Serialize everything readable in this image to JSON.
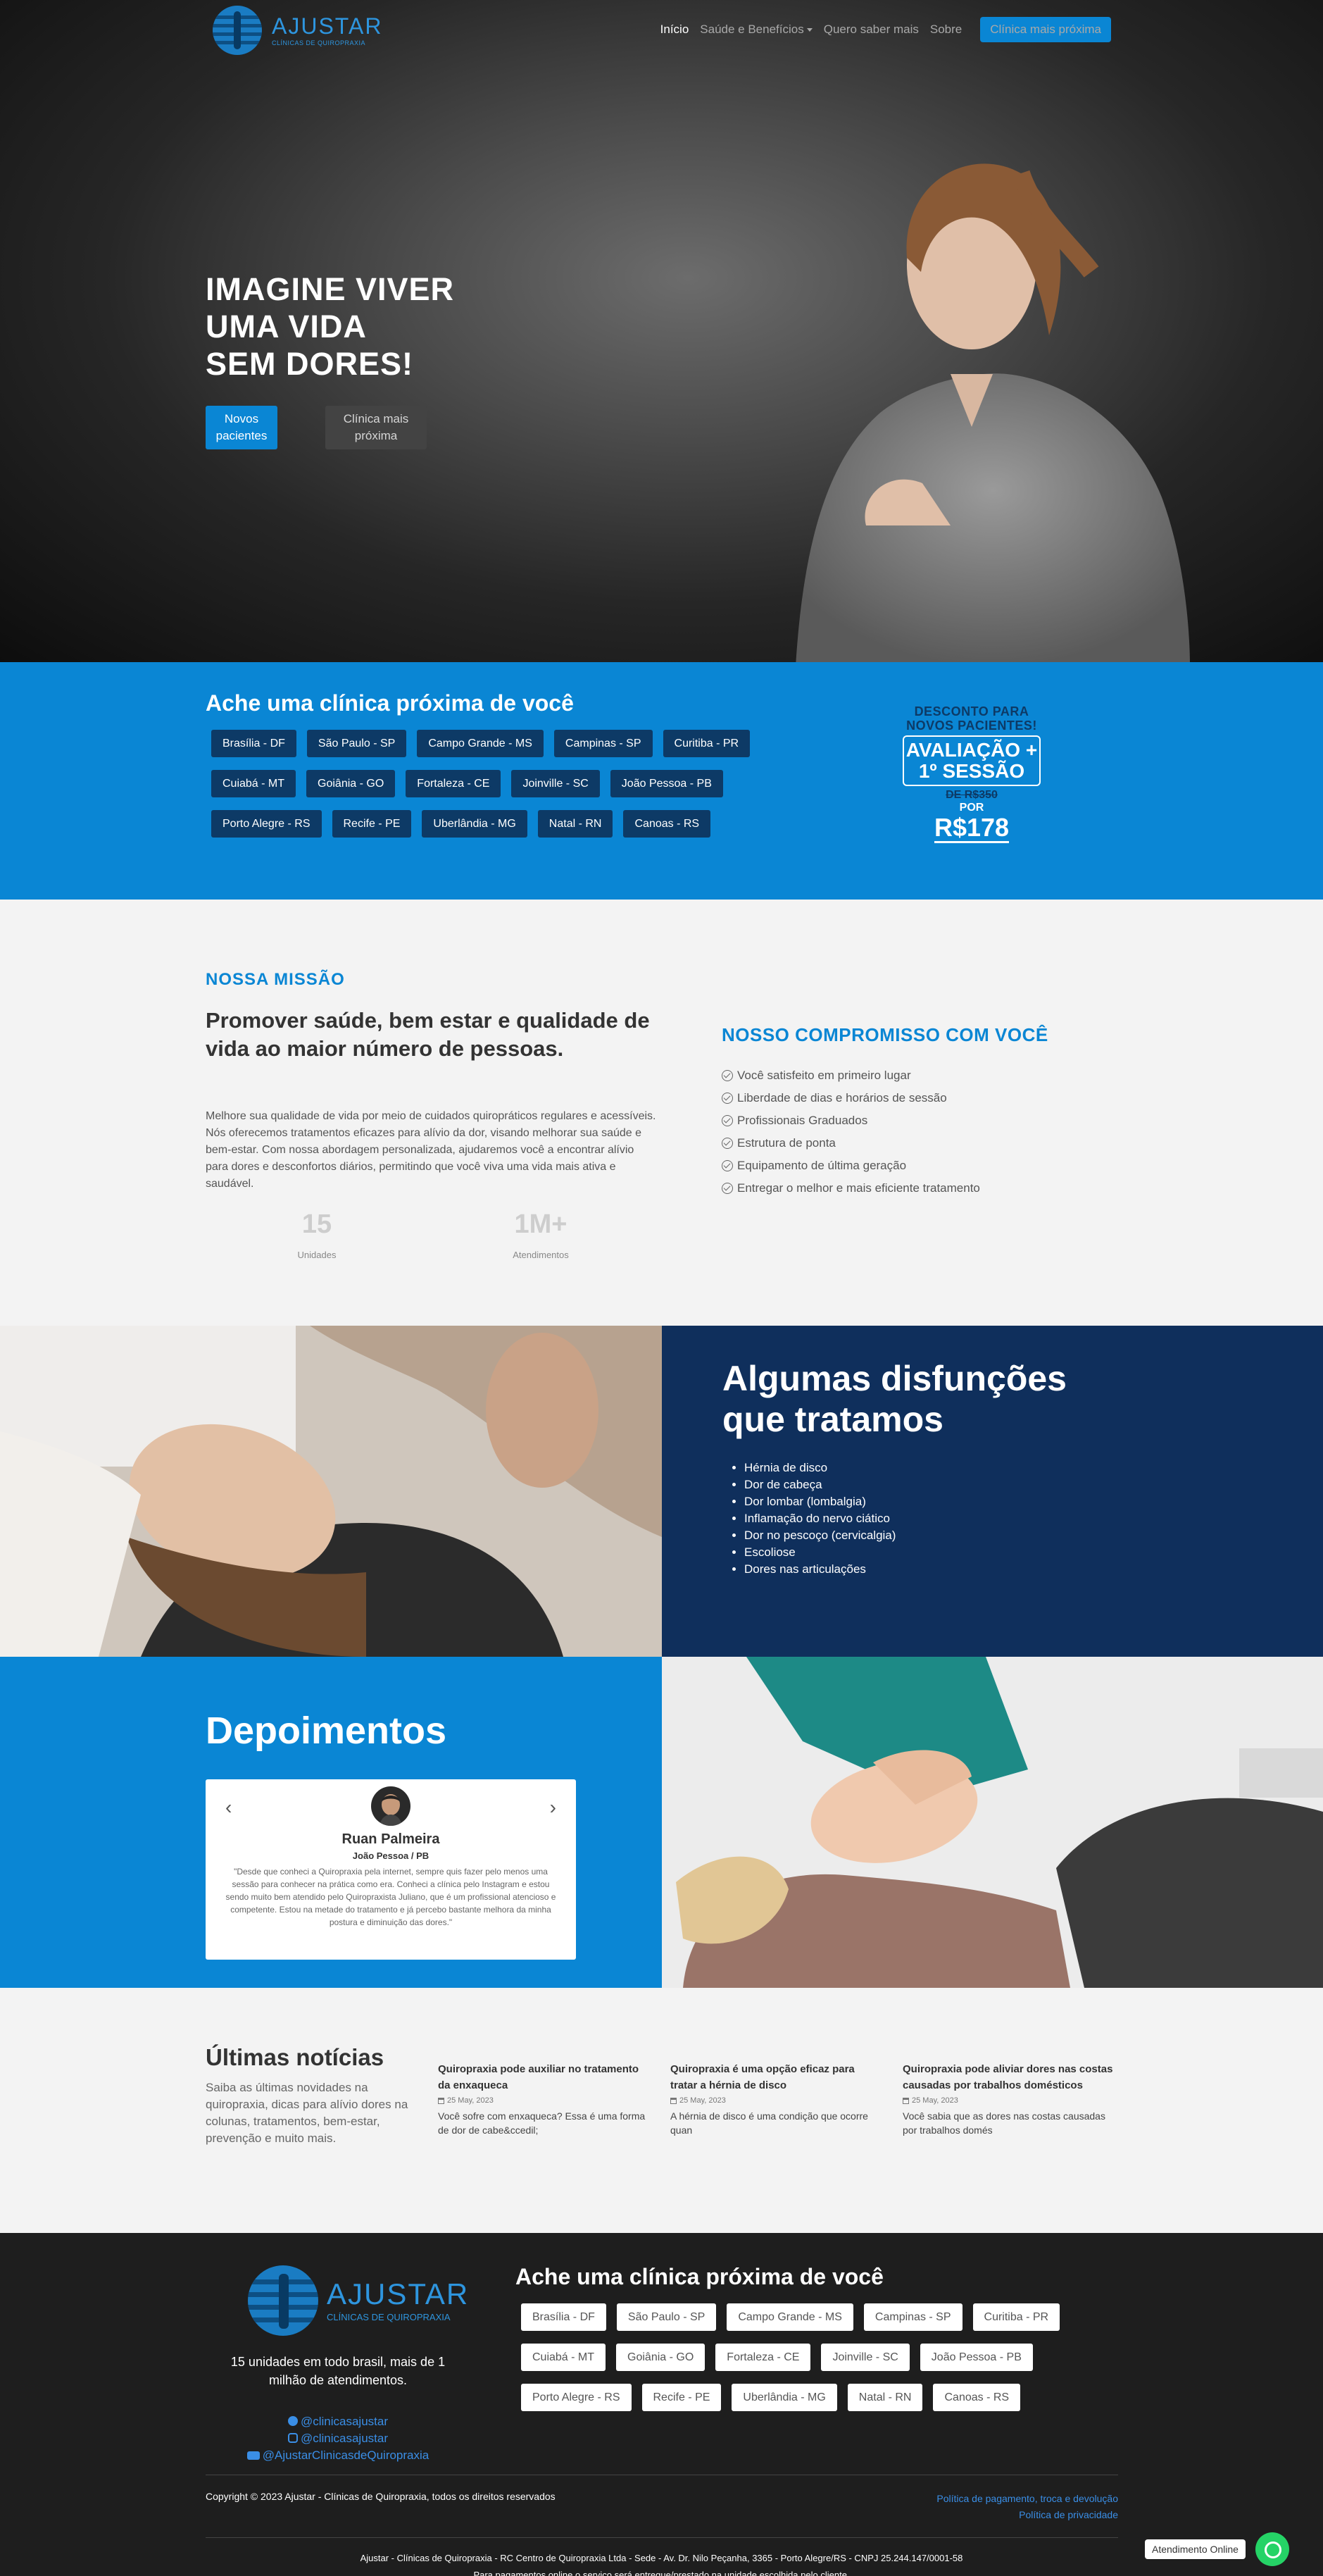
{
  "header": {
    "brand": "AJUSTAR",
    "brand_sub": "CLÍNICAS DE QUIROPRAXIA",
    "nav": [
      "Início",
      "Saúde e Benefícios",
      "Quero saber mais",
      "Sobre"
    ],
    "cta": "Clínica mais próxima"
  },
  "hero": {
    "title_lines": [
      "IMAGINE VIVER",
      "UMA VIDA",
      "SEM DORES!"
    ],
    "btn_primary": "Novos pacientes",
    "btn_secondary": "Clínica mais próxima"
  },
  "find": {
    "title": "Ache uma clínica próxima de você",
    "rows": [
      [
        "Brasília - DF",
        "São Paulo - SP",
        "Campo Grande - MS",
        "Campinas - SP",
        "Curitiba - PR"
      ],
      [
        "Cuiabá - MT",
        "Goiânia - GO",
        "Fortaleza - CE",
        "Joinville - SC",
        "João Pessoa - PB"
      ],
      [
        "Porto Alegre - RS",
        "Recife - PE",
        "Uberlândia - MG",
        "Natal - RN",
        "Canoas - RS"
      ]
    ],
    "promo": {
      "line1": "DESCONTO PARA NOVOS PACIENTES!",
      "line2": "AVALIAÇÃO + 1º SESSÃO",
      "old_price": "DE R$350",
      "por": "POR",
      "price": "R$178"
    }
  },
  "mission": {
    "kicker": "NOSSA MISSÃO",
    "headline": "Promover saúde, bem estar e qualidade de vida ao maior número de pessoas.",
    "body": "Melhore sua qualidade de vida por meio de cuidados quiropráticos regulares e acessíveis. Nós oferecemos tratamentos eficazes para alívio da dor, visando melhorar sua saúde e bem-estar. Com nossa abordagem personalizada, ajudaremos você a encontrar alívio para dores e desconfortos diários, permitindo que você viva uma vida mais ativa e saudável.",
    "stats": [
      {
        "num": "15",
        "label": "Unidades"
      },
      {
        "num": "1M+",
        "label": "Atendimentos"
      }
    ],
    "commit_title": "NOSSO COMPROMISSO COM VOCÊ",
    "commit_items": [
      "Você satisfeito em primeiro lugar",
      "Liberdade de dias e horários de sessão",
      "Profissionais Graduados",
      "Estrutura de ponta",
      "Equipamento de última geração",
      "Entregar o melhor e mais eficiente tratamento"
    ]
  },
  "disorders": {
    "title_lines": [
      "Algumas disfunções",
      "que tratamos"
    ],
    "items": [
      "Hérnia de disco",
      "Dor de cabeça",
      "Dor lombar (lombalgia)",
      "Inflamação do nervo ciático",
      "Dor no pescoço (cervicalgia)",
      "Escoliose",
      "Dores nas articulações"
    ]
  },
  "testimonials": {
    "title": "Depoimentos",
    "name": "Ruan Palmeira",
    "city": "João Pessoa / PB",
    "quote": "\"Desde que conheci a Quiropraxia pela internet, sempre quis fazer pelo menos uma sessão para conhecer na prática como era. Conheci a clínica pelo Instagram e estou sendo muito bem atendido pelo Quiropraxista Juliano, que é um profissional atencioso e competente. Estou na metade do tratamento e já percebo bastante melhora da minha postura e diminuição das dores.\""
  },
  "news": {
    "title": "Últimas notícias",
    "intro": "Saiba as últimas novidades na quiropraxia, dicas para alívio dores na colunas, tratamentos, bem-estar, prevenção e muito mais.",
    "posts": [
      {
        "title": "Quiropraxia pode auxiliar no tratamento da enxaqueca",
        "date": "25 May, 2023",
        "excerpt": "Você sofre com enxaqueca? Essa é uma forma de dor de cabe&ccedil;"
      },
      {
        "title": "Quiropraxia é uma opção eficaz para tratar a hérnia de disco",
        "date": "25 May, 2023",
        "excerpt": "A hérnia de disco é uma condição que ocorre quan"
      },
      {
        "title": "Quiropraxia pode aliviar dores nas costas causadas por trabalhos domésticos",
        "date": "25 May, 2023",
        "excerpt": "Você sabia que as dores nas costas causadas por trabalhos domés"
      }
    ]
  },
  "footer": {
    "tagline": "15 unidades em todo brasil, mais de 1 milhão de atendimentos.",
    "socials": [
      "@clinicasajustar",
      "@clinicasajustar",
      "@AjustarClinicasdeQuiropraxia"
    ],
    "find_title": "Ache uma clínica próxima de você",
    "copyright": "Copyright © 2023 Ajustar - Clínicas de Quiropraxia, todos os direitos reservados",
    "policy1": "Política de pagamento, troca e devolução",
    "policy2": "Política de privacidade",
    "legal1": "Ajustar - Clínicas de Quiropraxia - RC Centro de Quiropraxia Ltda - Sede - Av. Dr. Nilo Peçanha, 3365 - Porto Alegre/RS - CNPJ 25.244.147/0001-58",
    "legal2": "Para pagamentos online o serviço será entregue/prestado na unidade escolhida pelo cliente.",
    "chat": "Atendimento Online"
  },
  "colors": {
    "accent": "#0a86d4",
    "navy": "#0f2f5c",
    "city_btn": "#0d3a66",
    "footer_bg": "#1e1e1e"
  }
}
